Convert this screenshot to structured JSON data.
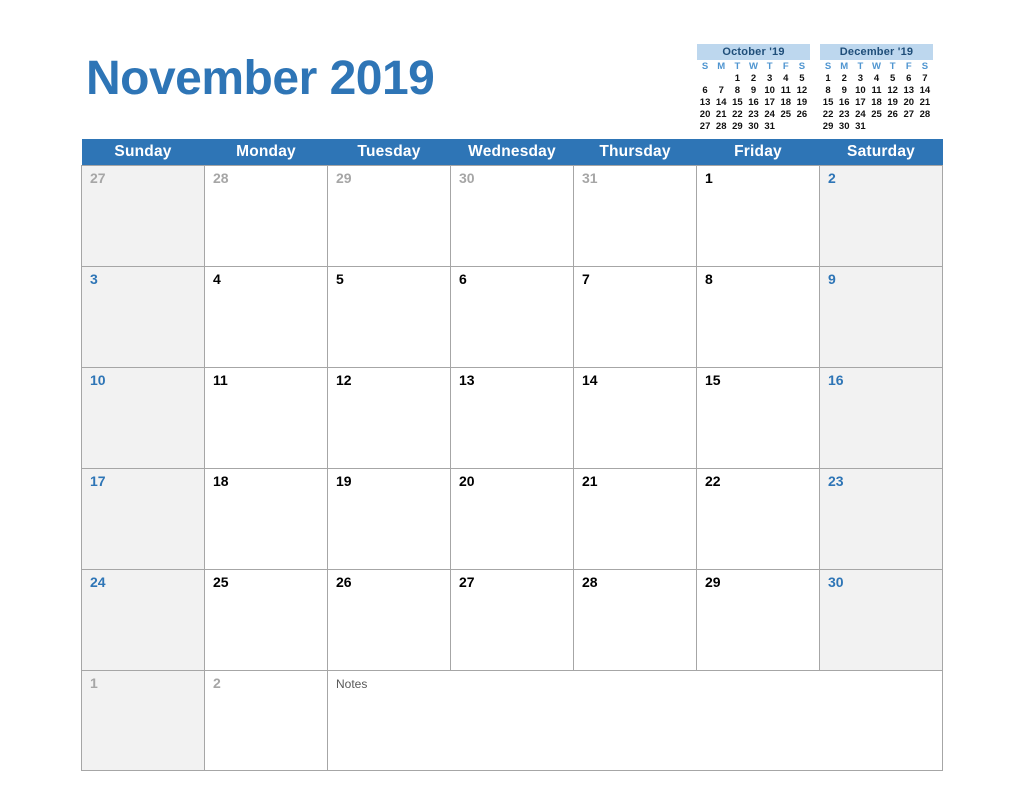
{
  "title": "November 2019",
  "colors": {
    "accent": "#2e75b6",
    "header_text": "#ffffff",
    "weekend_bg": "#f2f2f2",
    "out_month_text": "#a6a6a6",
    "mini_header_bg": "#bdd7ee",
    "mini_header_text": "#1f4e79",
    "mini_dow_text": "#4f95d0",
    "grid_line": "#a6a6a6",
    "notes_text": "#595959"
  },
  "weekday_headers": [
    "Sunday",
    "Monday",
    "Tuesday",
    "Wednesday",
    "Thursday",
    "Friday",
    "Saturday"
  ],
  "mini_calendars": [
    {
      "name": "october-2019",
      "title": "October '19",
      "dow": [
        "S",
        "M",
        "T",
        "W",
        "T",
        "F",
        "S"
      ],
      "weeks": [
        [
          "",
          "",
          "1",
          "2",
          "3",
          "4",
          "5"
        ],
        [
          "6",
          "7",
          "8",
          "9",
          "10",
          "11",
          "12"
        ],
        [
          "13",
          "14",
          "15",
          "16",
          "17",
          "18",
          "19"
        ],
        [
          "20",
          "21",
          "22",
          "23",
          "24",
          "25",
          "26"
        ],
        [
          "27",
          "28",
          "29",
          "30",
          "31",
          "",
          ""
        ]
      ]
    },
    {
      "name": "december-2019",
      "title": "December '19",
      "dow": [
        "S",
        "M",
        "T",
        "W",
        "T",
        "F",
        "S"
      ],
      "weeks": [
        [
          "1",
          "2",
          "3",
          "4",
          "5",
          "6",
          "7"
        ],
        [
          "8",
          "9",
          "10",
          "11",
          "12",
          "13",
          "14"
        ],
        [
          "15",
          "16",
          "17",
          "18",
          "19",
          "20",
          "21"
        ],
        [
          "22",
          "23",
          "24",
          "25",
          "26",
          "27",
          "28"
        ],
        [
          "29",
          "30",
          "31",
          "",
          "",
          "",
          ""
        ]
      ]
    }
  ],
  "weeks": [
    [
      {
        "num": "27",
        "in_month": false
      },
      {
        "num": "28",
        "in_month": false
      },
      {
        "num": "29",
        "in_month": false
      },
      {
        "num": "30",
        "in_month": false
      },
      {
        "num": "31",
        "in_month": false
      },
      {
        "num": "1",
        "in_month": true
      },
      {
        "num": "2",
        "in_month": true
      }
    ],
    [
      {
        "num": "3",
        "in_month": true
      },
      {
        "num": "4",
        "in_month": true
      },
      {
        "num": "5",
        "in_month": true
      },
      {
        "num": "6",
        "in_month": true
      },
      {
        "num": "7",
        "in_month": true
      },
      {
        "num": "8",
        "in_month": true
      },
      {
        "num": "9",
        "in_month": true
      }
    ],
    [
      {
        "num": "10",
        "in_month": true
      },
      {
        "num": "11",
        "in_month": true
      },
      {
        "num": "12",
        "in_month": true
      },
      {
        "num": "13",
        "in_month": true
      },
      {
        "num": "14",
        "in_month": true
      },
      {
        "num": "15",
        "in_month": true
      },
      {
        "num": "16",
        "in_month": true
      }
    ],
    [
      {
        "num": "17",
        "in_month": true
      },
      {
        "num": "18",
        "in_month": true
      },
      {
        "num": "19",
        "in_month": true
      },
      {
        "num": "20",
        "in_month": true
      },
      {
        "num": "21",
        "in_month": true
      },
      {
        "num": "22",
        "in_month": true
      },
      {
        "num": "23",
        "in_month": true
      }
    ],
    [
      {
        "num": "24",
        "in_month": true
      },
      {
        "num": "25",
        "in_month": true
      },
      {
        "num": "26",
        "in_month": true
      },
      {
        "num": "27",
        "in_month": true
      },
      {
        "num": "28",
        "in_month": true
      },
      {
        "num": "29",
        "in_month": true
      },
      {
        "num": "30",
        "in_month": true
      }
    ]
  ],
  "notes_row": {
    "cells": [
      {
        "num": "1",
        "in_month": false
      },
      {
        "num": "2",
        "in_month": false
      }
    ],
    "notes_label": "Notes",
    "notes_colspan": 5
  }
}
